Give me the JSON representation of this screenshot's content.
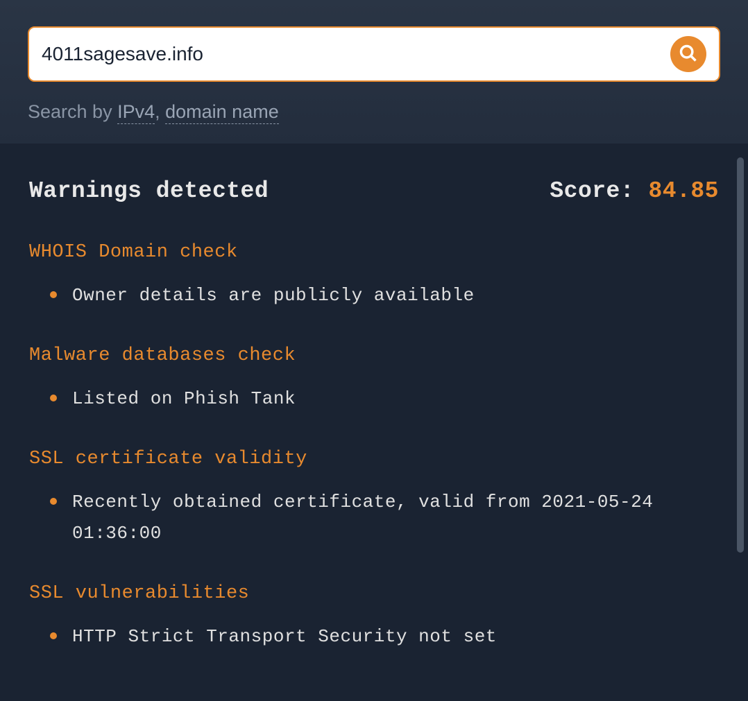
{
  "search": {
    "value": "4011sagesave.info",
    "placeholder": ""
  },
  "hint": {
    "prefix": "Search by ",
    "link1": "IPv4",
    "separator": ", ",
    "link2": "domain name"
  },
  "header": {
    "title": "Warnings detected",
    "score_label": "Score: ",
    "score_value": "84.85"
  },
  "sections": [
    {
      "title": "WHOIS Domain check",
      "items": [
        "Owner details are publicly available"
      ]
    },
    {
      "title": "Malware databases check",
      "items": [
        "Listed on Phish Tank"
      ]
    },
    {
      "title": "SSL certificate validity",
      "items": [
        "Recently obtained certificate, valid from 2021-05-24 01:36:00"
      ]
    },
    {
      "title": "SSL vulnerabilities",
      "items": [
        "HTTP Strict Transport Security not set"
      ]
    }
  ]
}
